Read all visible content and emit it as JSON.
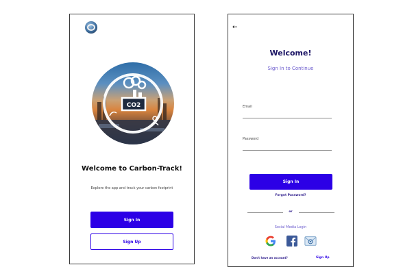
{
  "welcome_screen": {
    "title": "Welcome to Carbon-Track!",
    "subtitle": "Explore the app and track your carbon footprint",
    "hero_badge": "CO2",
    "signin_label": "Sign In",
    "signup_label": "Sign Up"
  },
  "login_screen": {
    "back_icon": "arrow-left-icon",
    "title": "Welcome!",
    "subtitle": "Sign In to Continue",
    "email_label": "Email",
    "password_label": "Password",
    "signin_label": "Sign In",
    "forgot_label": "Forgot Password?",
    "or_label": "or",
    "social_title": "Social Media Login",
    "social_icons": [
      "google-icon",
      "facebook-icon",
      "email-icon"
    ],
    "no_account_label": "Don't have an account?",
    "signup_link": "Sign Up"
  },
  "colors": {
    "primary": "#2c00e6",
    "title": "#1b1464",
    "accent": "#6a5acd"
  }
}
